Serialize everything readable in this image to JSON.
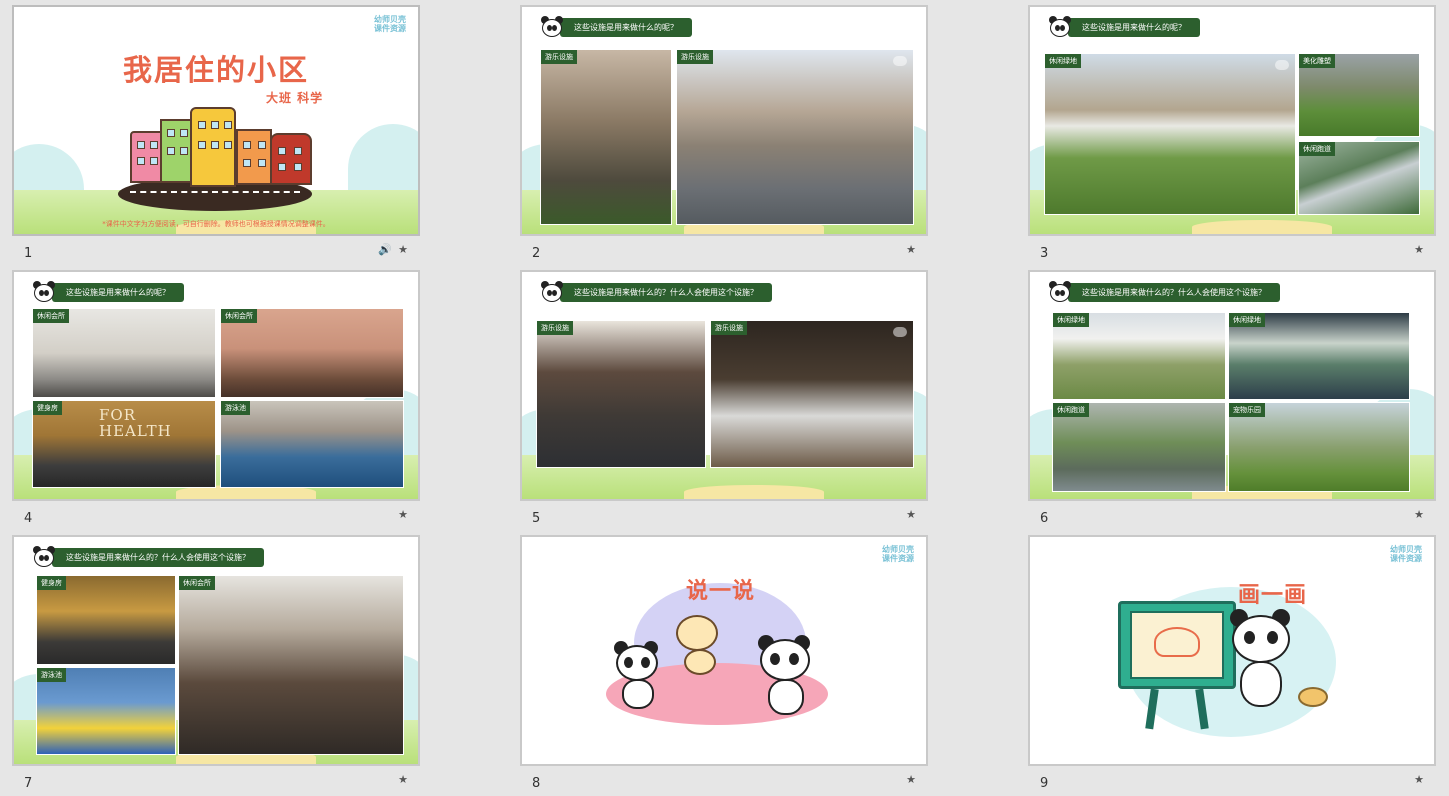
{
  "slides": [
    {
      "number": "1",
      "title": "我居住的小区",
      "subtitle": "大班 科学",
      "note": "*课件中文字为方便阅读，可自行删除。教师也可根据授课情况调整课件。",
      "has_audio": true
    },
    {
      "number": "2",
      "question": "这些设施是用来做什么的呢？",
      "photos": [
        "游乐设施",
        "游乐设施"
      ]
    },
    {
      "number": "3",
      "question": "这些设施是用来做什么的呢？",
      "photos": [
        "休闲绿地",
        "美化雕塑",
        "休闲跑道"
      ]
    },
    {
      "number": "4",
      "question": "这些设施是用来做什么的呢？",
      "photos": [
        "休闲会所",
        "休闲会所",
        "健身房",
        "游泳池"
      ],
      "gym_sign": "FOR HEALTH"
    },
    {
      "number": "5",
      "question": "这些设施是用来做什么的？什么人会使用这个设施？",
      "photos": [
        "游乐设施",
        "游乐设施"
      ]
    },
    {
      "number": "6",
      "question": "这些设施是用来做什么的？什么人会使用这个设施？",
      "photos": [
        "休闲绿地",
        "休闲绿地",
        "休闲跑道",
        "宠物乐园"
      ]
    },
    {
      "number": "7",
      "question": "这些设施是用来做什么的？什么人会使用这个设施？",
      "photos": [
        "健身房",
        "休闲会所",
        "游泳池"
      ]
    },
    {
      "number": "8",
      "heading": "说一说"
    },
    {
      "number": "9",
      "heading": "画一画"
    }
  ],
  "logo": {
    "line1": "幼师贝壳",
    "line2": "课件资源"
  },
  "icons": {
    "star": "★",
    "audio": "🔊"
  }
}
